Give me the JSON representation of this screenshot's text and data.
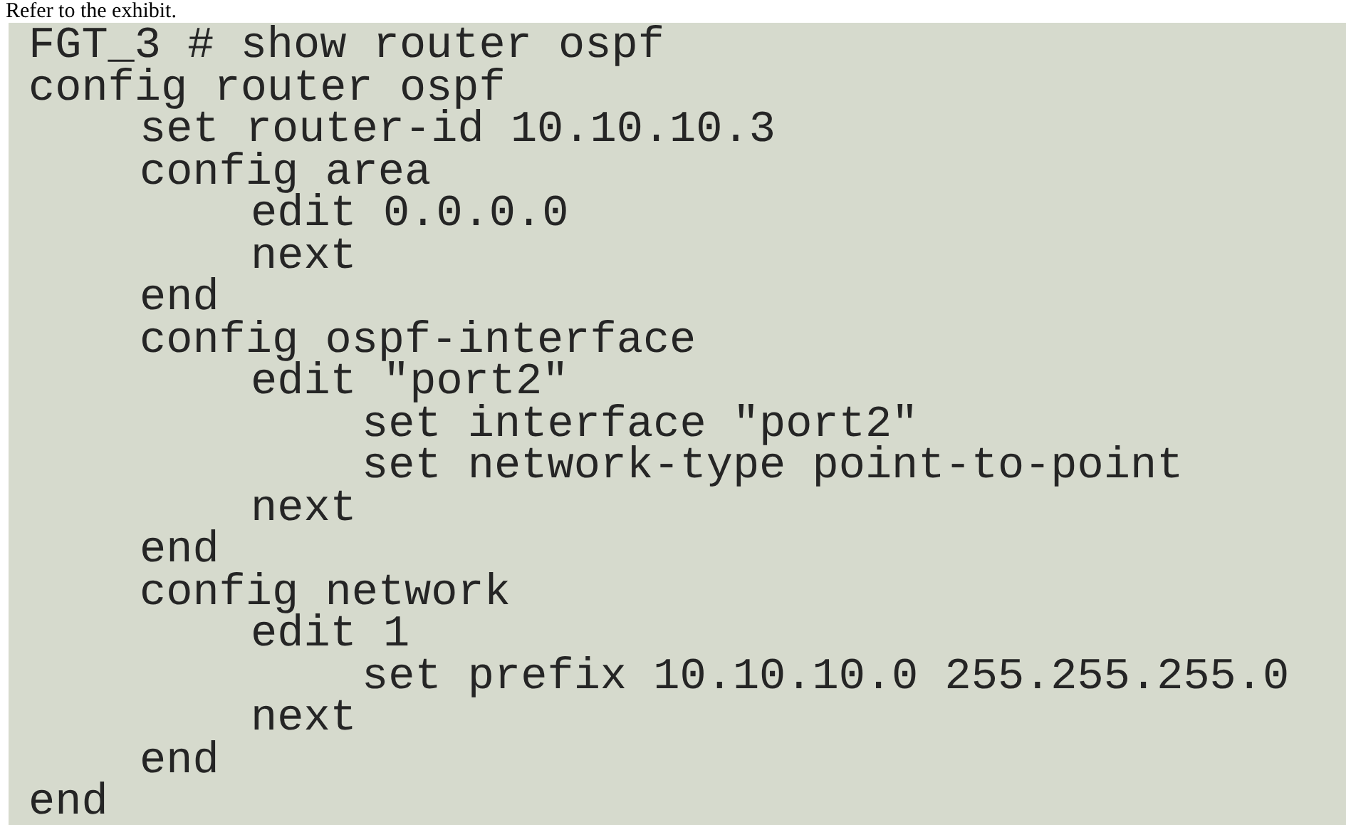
{
  "caption": "Refer to the exhibit.",
  "terminal": {
    "prompt": "FGT_3 # show router ospf",
    "lines": [
      {
        "text": "config router ospf",
        "children": [
          {
            "text": "set router-id 10.10.10.3"
          },
          {
            "text": "config area",
            "children": [
              {
                "text": "edit 0.0.0.0"
              },
              {
                "text": "next"
              }
            ]
          },
          {
            "text": "end"
          },
          {
            "text": "config ospf-interface",
            "children": [
              {
                "text": "edit \"port2\"",
                "children": [
                  {
                    "text": "set interface \"port2\""
                  },
                  {
                    "text": "set network-type point-to-point"
                  }
                ]
              },
              {
                "text": "next"
              }
            ]
          },
          {
            "text": "end"
          },
          {
            "text": "config network",
            "children": [
              {
                "text": "edit 1",
                "children": [
                  {
                    "text": "set prefix 10.10.10.0 255.255.255.0"
                  }
                ]
              },
              {
                "text": "next"
              }
            ]
          },
          {
            "text": "end"
          }
        ]
      },
      {
        "text": "end"
      }
    ]
  }
}
